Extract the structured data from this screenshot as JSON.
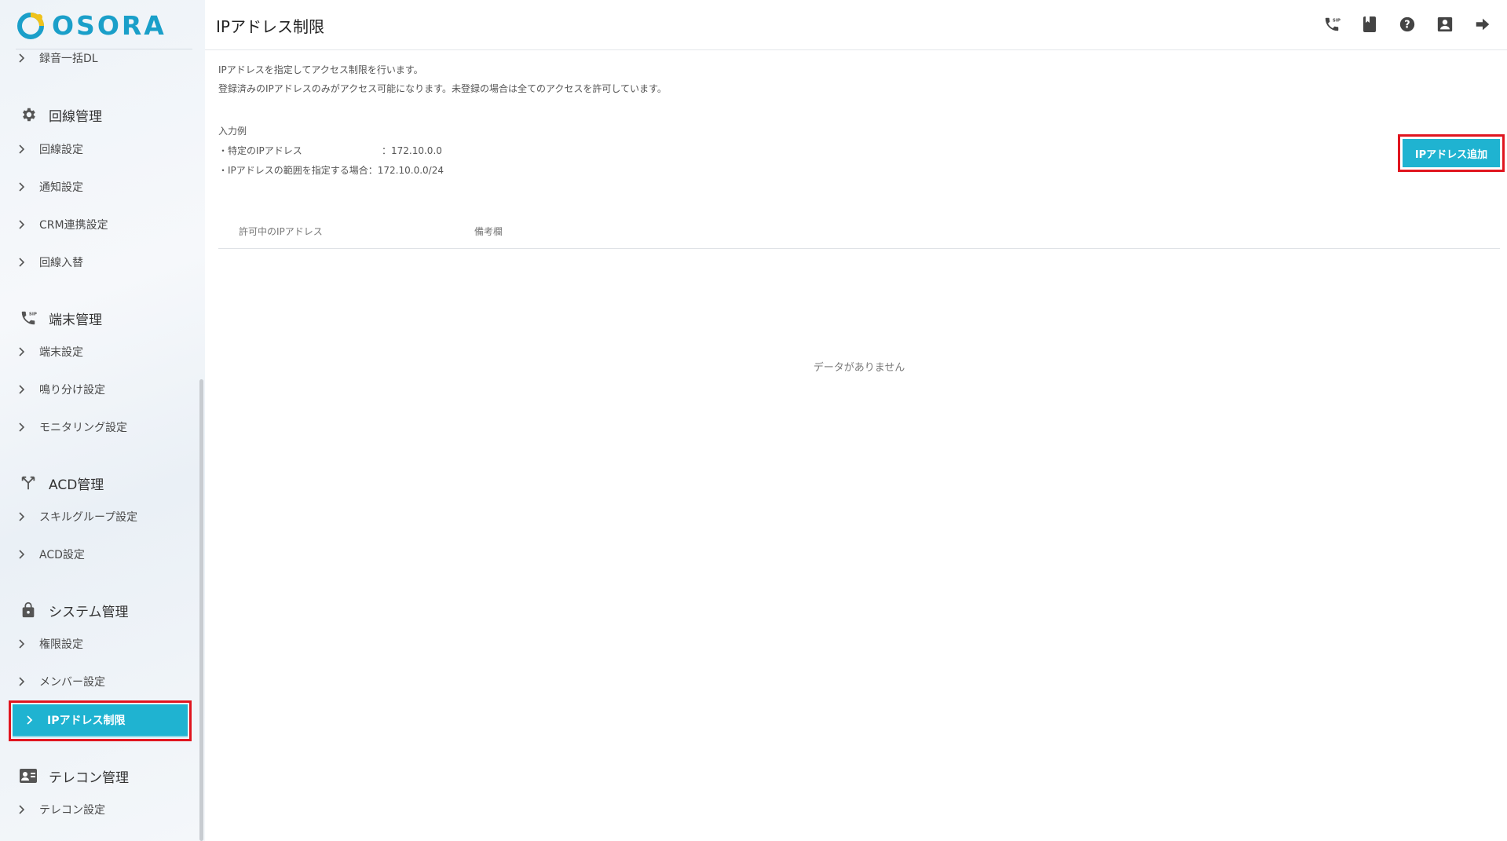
{
  "logo": {
    "text": "OSORA"
  },
  "sidebar": {
    "top_item": "録音一括DL",
    "sections": [
      {
        "heading": "回線管理",
        "icon": "gear-icon",
        "items": [
          "回線設定",
          "通知設定",
          "CRM連携設定",
          "回線入替"
        ]
      },
      {
        "heading": "端末管理",
        "icon": "sip-phone-icon",
        "items": [
          "端末設定",
          "鳴り分け設定",
          "モニタリング設定"
        ]
      },
      {
        "heading": "ACD管理",
        "icon": "merge-arrow-icon",
        "items": [
          "スキルグループ設定",
          "ACD設定"
        ]
      },
      {
        "heading": "システム管理",
        "icon": "lock-icon",
        "items": [
          "権限設定",
          "メンバー設定",
          "IPアドレス制限"
        ]
      },
      {
        "heading": "テレコン管理",
        "icon": "contact-card-icon",
        "items": [
          "テレコン設定"
        ]
      }
    ],
    "active_item": "IPアドレス制限"
  },
  "header": {
    "title": "IPアドレス制限",
    "icons": [
      "sip-phone-icon",
      "book-icon",
      "help-icon",
      "account-box-icon",
      "logout-arrow-icon"
    ]
  },
  "main": {
    "description_1": "IPアドレスを指定してアクセス制限を行います。",
    "description_2": "登録済みのIPアドレスのみがアクセス可能になります。未登録の場合は全てのアクセスを許可しています。",
    "example_title": "入力例",
    "example_1_label": "・特定のIPアドレス",
    "example_1_value": "：172.10.0.0",
    "example_2_label": "・IPアドレスの範囲を指定する場合",
    "example_2_value": "：172.10.0.0/24",
    "add_button": "IPアドレス追加",
    "table": {
      "columns": [
        "許可中のIPアドレス",
        "備考欄"
      ]
    },
    "empty_message": "データがありません"
  },
  "colors": {
    "accent": "#1fb3d1",
    "highlight": "#e0151f",
    "brand": "#1a9fc9"
  }
}
